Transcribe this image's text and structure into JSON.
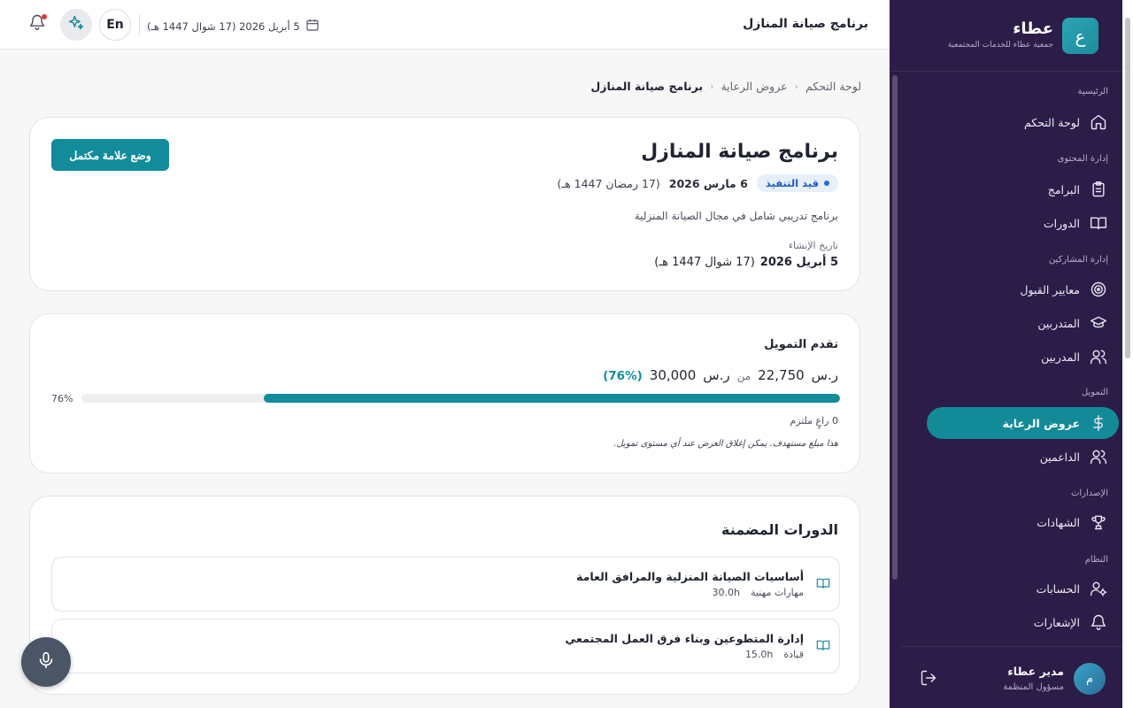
{
  "brand": {
    "logo_letter": "ع",
    "name": "عطاء",
    "subtitle": "جمعية عطاء للخدمات المجتمعية"
  },
  "sidebar": {
    "sections": [
      {
        "title": "الرئيسية",
        "items": [
          {
            "label": "لوحة التحكم",
            "icon": "home-icon"
          }
        ]
      },
      {
        "title": "إدارة المحتوى",
        "items": [
          {
            "label": "البرامج",
            "icon": "clipboard-icon"
          },
          {
            "label": "الدورات",
            "icon": "book-icon"
          }
        ]
      },
      {
        "title": "إدارة المشاركين",
        "items": [
          {
            "label": "معايير القبول",
            "icon": "target-icon"
          },
          {
            "label": "المتدربين",
            "icon": "graduation-cap-icon"
          },
          {
            "label": "المدربين",
            "icon": "users-icon"
          }
        ]
      },
      {
        "title": "التمويل",
        "items": [
          {
            "label": "عروض الرعاية",
            "icon": "dollar-icon",
            "active": true
          },
          {
            "label": "الداعمين",
            "icon": "users-icon"
          }
        ]
      },
      {
        "title": "الإصدارات",
        "items": [
          {
            "label": "الشهادات",
            "icon": "trophy-icon"
          }
        ]
      },
      {
        "title": "النظام",
        "items": [
          {
            "label": "الحسابات",
            "icon": "user-cog-icon"
          },
          {
            "label": "الإشعارات",
            "icon": "bell-icon"
          }
        ]
      }
    ],
    "user": {
      "avatar_letter": "م",
      "name": "مدير عطاء",
      "role": "مسؤول المنظمة"
    }
  },
  "topbar": {
    "title": "برنامج صيانة المنازل",
    "date": "5 أبريل 2026 (17 شوال 1447 هـ)",
    "lang_label": "En"
  },
  "breadcrumb": {
    "items": [
      "لوحة التحكم",
      "عروض الرعاية",
      "برنامج صيانة المنازل"
    ]
  },
  "program": {
    "title": "برنامج صيانة المنازل",
    "status": "قيد التنفيذ",
    "start_date": "6 مارس 2026",
    "start_hijri": "(17 رمضان 1447 هـ)",
    "description": "برنامج تدريبي شامل في مجال الصيانة المنزلية",
    "created_label": "تاريخ الإنشاء",
    "created_date": "5 أبريل 2026",
    "created_hijri": "(17 شوال 1447 هـ)",
    "complete_button": "وضع علامة مكتمل"
  },
  "funding": {
    "title": "تقدم التمويل",
    "raised": "22,750",
    "currency": "ر.س",
    "of_label": "من",
    "target": "30,000",
    "percent_text": "(76%)",
    "percent_label": "76%",
    "progress": 0.76,
    "sponsors": "0 راعٍ ملتزم",
    "note": "هذا مبلغ مستهدف. يمكن إغلاق العرض عند أي مستوى تمويل."
  },
  "courses": {
    "title": "الدورات المضمنة",
    "items": [
      {
        "name": "أساسيات الصيانة المنزلية والمرافق العامة",
        "category": "مهارات مهنية",
        "hours": "30.0h"
      },
      {
        "name": "إدارة المتطوعين وبناء فرق العمل المجتمعي",
        "category": "قيادة",
        "hours": "15.0h"
      }
    ]
  },
  "colors": {
    "sidebar_bg": "#2b1d48",
    "accent": "#128c9a",
    "status_blue": "#1f5bbd"
  }
}
